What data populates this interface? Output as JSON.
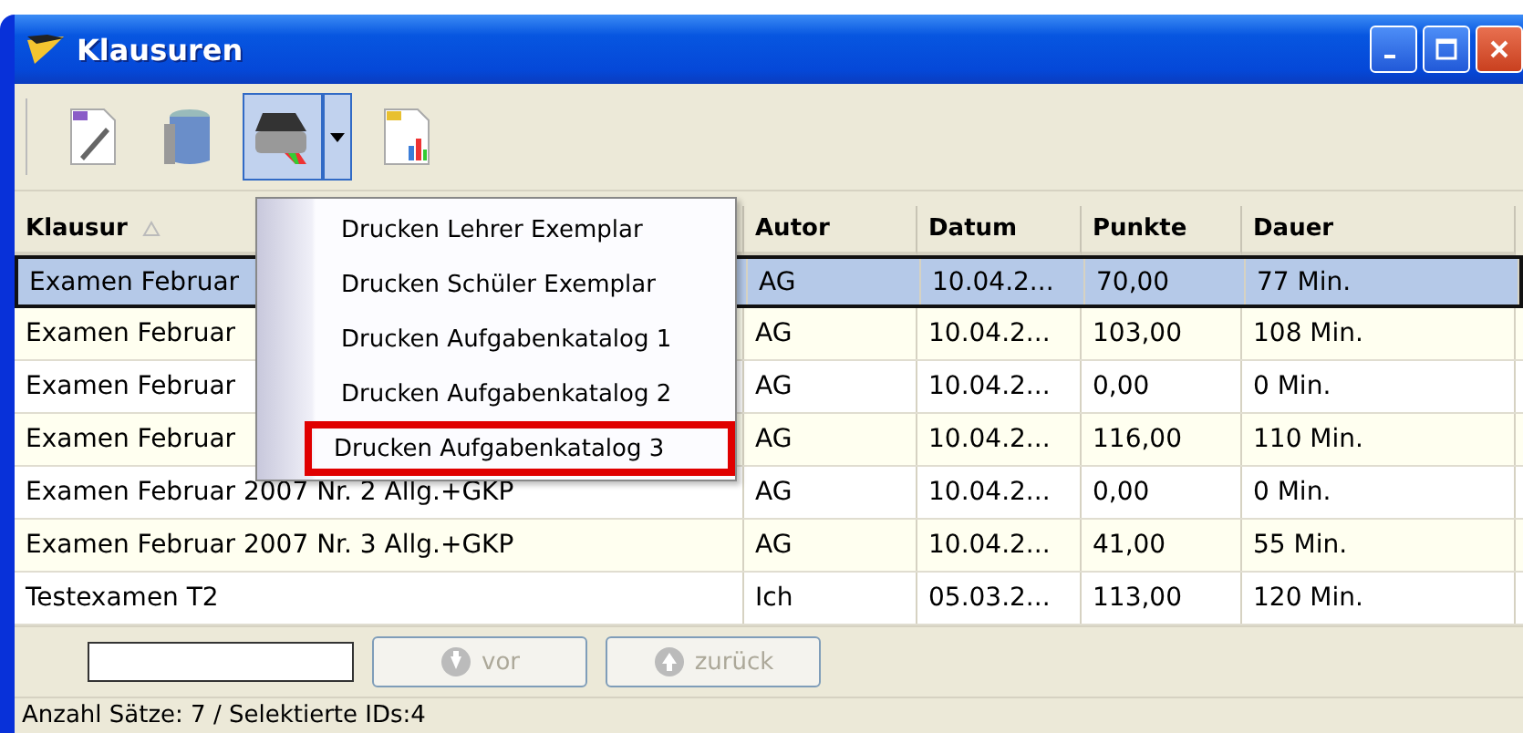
{
  "window": {
    "title": "Klausuren"
  },
  "toolbar": {
    "buttons": [
      {
        "kind": "edit",
        "pressed": false
      },
      {
        "kind": "trash",
        "pressed": false
      },
      {
        "kind": "print",
        "pressed": true
      },
      {
        "kind": "report",
        "pressed": false
      }
    ]
  },
  "print_menu": {
    "items": [
      {
        "label": "Drucken Lehrer Exemplar",
        "highlighted": false
      },
      {
        "label": "Drucken Schüler Exemplar",
        "highlighted": false
      },
      {
        "label": "Drucken Aufgabenkatalog 1",
        "highlighted": false
      },
      {
        "label": "Drucken Aufgabenkatalog 2",
        "highlighted": false
      },
      {
        "label": "Drucken Aufgabenkatalog 3",
        "highlighted": true
      }
    ]
  },
  "table": {
    "columns": [
      {
        "label": "Klausur",
        "sorted": true
      },
      {
        "label": "Autor",
        "sorted": false
      },
      {
        "label": "Datum",
        "sorted": false
      },
      {
        "label": "Punkte",
        "sorted": false
      },
      {
        "label": "Dauer",
        "sorted": false
      }
    ],
    "rows": [
      {
        "selected": true,
        "cells": [
          "Examen Februar",
          "AG",
          "10.04.2...",
          "70,00",
          "77 Min."
        ]
      },
      {
        "selected": false,
        "cells": [
          "Examen Februar",
          "AG",
          "10.04.2...",
          "103,00",
          "108 Min."
        ]
      },
      {
        "selected": false,
        "cells": [
          "Examen Februar",
          "AG",
          "10.04.2...",
          "0,00",
          "0 Min."
        ]
      },
      {
        "selected": false,
        "cells": [
          "Examen Februar",
          "AG",
          "10.04.2...",
          "116,00",
          "110 Min."
        ]
      },
      {
        "selected": false,
        "cells": [
          "Examen Februar 2007 Nr. 2 Allg.+GKP",
          "AG",
          "10.04.2...",
          "0,00",
          "0 Min."
        ]
      },
      {
        "selected": false,
        "cells": [
          "Examen Februar 2007 Nr. 3 Allg.+GKP",
          "AG",
          "10.04.2...",
          "41,00",
          "55 Min."
        ]
      },
      {
        "selected": false,
        "cells": [
          "Testexamen T2",
          "Ich",
          "05.03.2...",
          "113,00",
          "120 Min."
        ]
      }
    ]
  },
  "navigation": {
    "buttons": [
      {
        "label": "vor",
        "kind": "down",
        "disabled": true
      },
      {
        "label": "zurück",
        "kind": "up",
        "disabled": true
      }
    ]
  },
  "status_bar": "Anzahl Sätze: 7 / Selektierte IDs:4"
}
